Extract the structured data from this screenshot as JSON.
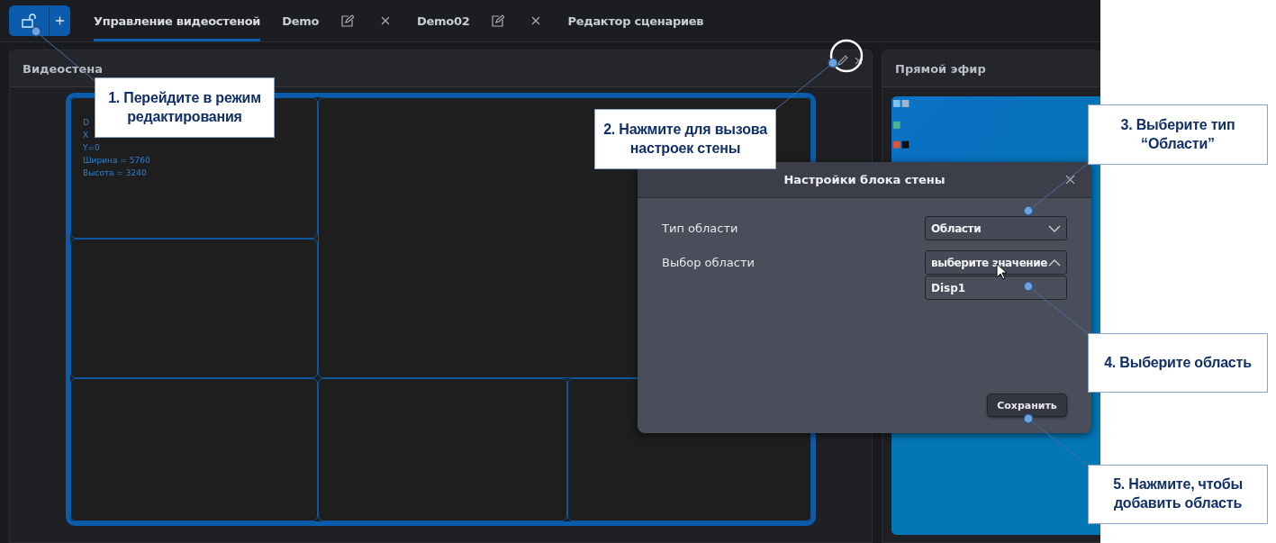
{
  "toolbar": {
    "tabs": [
      {
        "label": "Управление видеостеной",
        "selected": true,
        "kind": "plain"
      },
      {
        "label": "Demo",
        "selected": false,
        "kind": "editable"
      },
      {
        "label": "Demo02",
        "selected": false,
        "kind": "editable"
      },
      {
        "label": "Редактор сценариев",
        "selected": false,
        "kind": "plain"
      }
    ]
  },
  "video_wall": {
    "title": "Видеостена",
    "info_lines": [
      "D",
      "X",
      "Y=0",
      "Ширина = 5760",
      "Высота = 3240"
    ]
  },
  "live": {
    "title": "Прямой эфир"
  },
  "dialog": {
    "title": "Настройки блока стены",
    "fields": [
      {
        "label": "Тип области",
        "value": "Области",
        "expanded": false
      },
      {
        "label": "Выбор области",
        "value": "выберите значение",
        "expanded": true,
        "options": [
          "Disp1"
        ]
      }
    ],
    "save": "Сохранить"
  },
  "callouts": [
    {
      "text": "1. Перейдите в режим\nредактирования"
    },
    {
      "text": "2. Нажмите для вызова\nнастроек стены"
    },
    {
      "text": "3. Выберите тип\n“Области”"
    },
    {
      "text": "4. Выберите область"
    },
    {
      "text": "5. Нажмите, чтобы\nдобавить область"
    }
  ]
}
